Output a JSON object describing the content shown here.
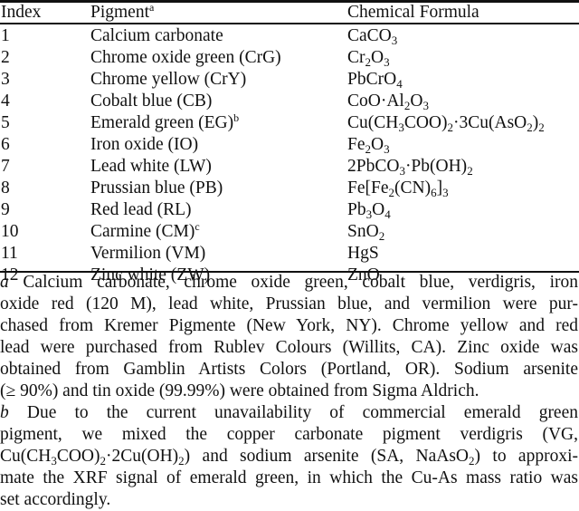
{
  "table": {
    "headers": {
      "index": "Index",
      "pigment": "Pigment",
      "pigment_footnote": "a",
      "formula": "Chemical Formula"
    },
    "rows": [
      {
        "index": "1",
        "pigment": "Calcium carbonate",
        "pigment_note": "",
        "formula": [
          [
            "CaCO",
            ""
          ],
          [
            "3",
            "sub"
          ]
        ]
      },
      {
        "index": "2",
        "pigment": "Chrome oxide green (CrG)",
        "pigment_note": "",
        "formula": [
          [
            "Cr",
            ""
          ],
          [
            "2",
            "sub"
          ],
          [
            "O",
            ""
          ],
          [
            "3",
            "sub"
          ]
        ]
      },
      {
        "index": "3",
        "pigment": "Chrome yellow (CrY)",
        "pigment_note": "",
        "formula": [
          [
            "PbCrO",
            ""
          ],
          [
            "4",
            "sub"
          ]
        ]
      },
      {
        "index": "4",
        "pigment": "Cobalt blue (CB)",
        "pigment_note": "",
        "formula": [
          [
            "CoO·Al",
            ""
          ],
          [
            "2",
            "sub"
          ],
          [
            "O",
            ""
          ],
          [
            "3",
            "sub"
          ]
        ]
      },
      {
        "index": "5",
        "pigment": "Emerald green (EG)",
        "pigment_note": "b",
        "formula": [
          [
            "Cu(CH",
            ""
          ],
          [
            "3",
            "sub"
          ],
          [
            "COO)",
            ""
          ],
          [
            "2",
            "sub"
          ],
          [
            "·3Cu(AsO",
            ""
          ],
          [
            "2",
            "sub"
          ],
          [
            ")",
            ""
          ],
          [
            "2",
            "sub"
          ]
        ]
      },
      {
        "index": "6",
        "pigment": "Iron oxide (IO)",
        "pigment_note": "",
        "formula": [
          [
            "Fe",
            ""
          ],
          [
            "2",
            "sub"
          ],
          [
            "O",
            ""
          ],
          [
            "3",
            "sub"
          ]
        ]
      },
      {
        "index": "7",
        "pigment": "Lead white (LW)",
        "pigment_note": "",
        "formula": [
          [
            "2PbCO",
            ""
          ],
          [
            "3",
            "sub"
          ],
          [
            "·Pb(OH)",
            ""
          ],
          [
            "2",
            "sub"
          ]
        ]
      },
      {
        "index": "8",
        "pigment": "Prussian blue (PB)",
        "pigment_note": "",
        "formula": [
          [
            "Fe[Fe",
            ""
          ],
          [
            "2",
            "sub"
          ],
          [
            "(CN)",
            ""
          ],
          [
            "6",
            "sub"
          ],
          [
            "]",
            ""
          ],
          [
            "3",
            "sub"
          ]
        ]
      },
      {
        "index": "9",
        "pigment": "Red lead (RL)",
        "pigment_note": "",
        "formula": [
          [
            "Pb",
            ""
          ],
          [
            "3",
            "sub"
          ],
          [
            "O",
            ""
          ],
          [
            "4",
            "sub"
          ]
        ]
      },
      {
        "index": "10",
        "pigment": "Carmine (CM)",
        "pigment_note": "c",
        "formula": [
          [
            "SnO",
            ""
          ],
          [
            "2",
            "sub"
          ]
        ]
      },
      {
        "index": "11",
        "pigment": "Vermilion (VM)",
        "pigment_note": "",
        "formula": [
          [
            "HgS",
            ""
          ]
        ]
      },
      {
        "index": "12",
        "pigment": "Zinc white (ZW)",
        "pigment_note": "",
        "formula": [
          [
            "ZnO",
            ""
          ]
        ]
      }
    ]
  },
  "footnotes": [
    {
      "mark": "a",
      "lines": [
        [
          [
            "Calcium carbonate, chrome oxide green, cobalt blue, verdigris, iron",
            ""
          ]
        ],
        [
          [
            "oxide red (120 M), lead white, Prussian blue, and vermilion were pur-",
            ""
          ]
        ],
        [
          [
            "chased from Kremer Pigmente (New York, NY). Chrome yellow and red",
            ""
          ]
        ],
        [
          [
            "lead were purchased from Rublev Colours (Willits, CA). Zinc oxide was",
            ""
          ]
        ],
        [
          [
            "obtained from Gamblin Artists Colors (Portland, OR). Sodium arsenite",
            ""
          ]
        ],
        [
          [
            "(≥ 90%) and tin oxide (99.99%) were obtained from Sigma Aldrich.",
            ""
          ]
        ]
      ]
    },
    {
      "mark": "b",
      "lines": [
        [
          [
            "Due to the current unavailability of commercial emerald green",
            ""
          ]
        ],
        [
          [
            "pigment, we mixed the copper carbonate pigment verdigris (VG,",
            ""
          ]
        ],
        [
          [
            "Cu(CH",
            ""
          ],
          [
            "3",
            "sub"
          ],
          [
            "COO)",
            ""
          ],
          [
            "2",
            "sub"
          ],
          [
            "·2Cu(OH)",
            ""
          ],
          [
            "2",
            "sub"
          ],
          [
            ") and sodium arsenite (SA, NaAsO",
            ""
          ],
          [
            "2",
            "sub"
          ],
          [
            ") to approxi-",
            ""
          ]
        ],
        [
          [
            "mate the XRF signal of emerald green, in which the Cu-As mass ratio was",
            ""
          ]
        ],
        [
          [
            "set accordingly.",
            ""
          ]
        ]
      ]
    }
  ]
}
